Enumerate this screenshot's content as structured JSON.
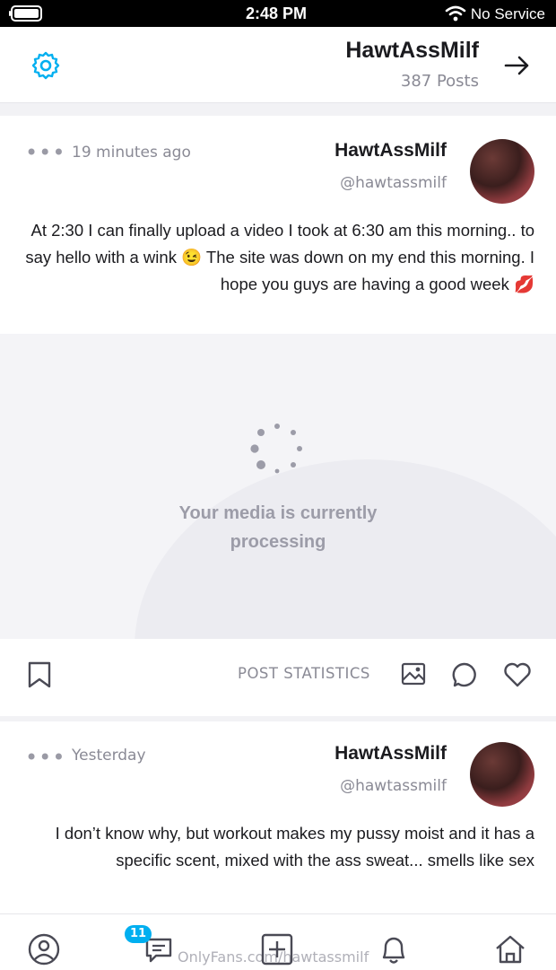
{
  "status_bar": {
    "carrier": "No Service",
    "time": "2:48 PM"
  },
  "header": {
    "name": "HawtAssMilf",
    "posts_count": "387 Posts"
  },
  "posts": [
    {
      "name": "HawtAssMilf",
      "handle": "@hawtassmilf",
      "time": "19 minutes ago",
      "text": "At 2:30 I can finally upload a video I took at 6:30 am this morning.. to say hello with a wink 😉 The site was down on my end this morning. I hope you guys are having a good week 💋",
      "media_status": "Your media is currently processing",
      "stats_label": "POST STATISTICS"
    },
    {
      "name": "HawtAssMilf",
      "handle": "@hawtassmilf",
      "time": "Yesterday",
      "text": "I don’t know why, but workout makes my pussy moist and it has a specific scent, mixed with the ass sweat... smells like sex"
    }
  ],
  "bottom_nav": {
    "messages_badge": "11",
    "watermark": "OnlyFans.com/hawtassmilf"
  },
  "colors": {
    "accent": "#00aff0",
    "muted_text": "#8a8a95",
    "icon": "#4a4a55"
  }
}
